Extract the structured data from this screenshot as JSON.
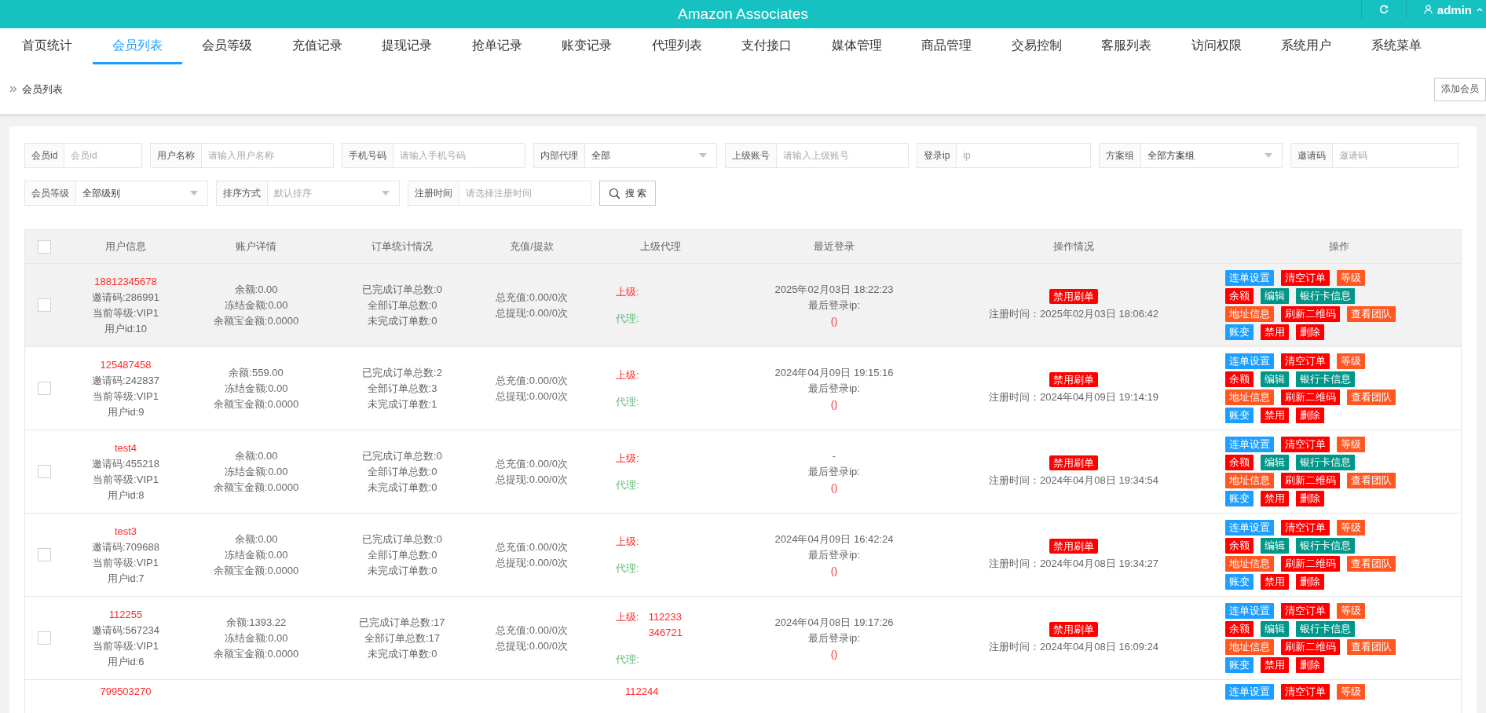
{
  "header": {
    "title": "Amazon Associates",
    "user": "admin"
  },
  "nav": [
    {
      "label": "首页统计",
      "selected": false
    },
    {
      "label": "会员列表",
      "selected": true
    },
    {
      "label": "会员等级",
      "selected": false
    },
    {
      "label": "充值记录",
      "selected": false
    },
    {
      "label": "提现记录",
      "selected": false
    },
    {
      "label": "抢单记录",
      "selected": false
    },
    {
      "label": "账变记录",
      "selected": false
    },
    {
      "label": "代理列表",
      "selected": false
    },
    {
      "label": "支付接口",
      "selected": false
    },
    {
      "label": "媒体管理",
      "selected": false
    },
    {
      "label": "商品管理",
      "selected": false
    },
    {
      "label": "交易控制",
      "selected": false
    },
    {
      "label": "客服列表",
      "selected": false
    },
    {
      "label": "访问权限",
      "selected": false
    },
    {
      "label": "系统用户",
      "selected": false
    },
    {
      "label": "系统菜单",
      "selected": false
    }
  ],
  "breadcrumb": "会员列表",
  "add_button": "添加会员",
  "filters": [
    {
      "label": "会员id",
      "kind": "input",
      "placeholder": "会员id"
    },
    {
      "label": "用户名称",
      "kind": "input",
      "placeholder": "请输入用户名称"
    },
    {
      "label": "手机号码",
      "kind": "input",
      "placeholder": "请输入手机号码"
    },
    {
      "label": "内部代理",
      "kind": "select",
      "value": "全部"
    },
    {
      "label": "上级账号",
      "kind": "input",
      "placeholder": "请输入上级账号"
    },
    {
      "label": "登录ip",
      "kind": "input",
      "placeholder": "ip"
    },
    {
      "label": "方案组",
      "kind": "select",
      "value": "全部方案组"
    },
    {
      "label": "邀请码",
      "kind": "input",
      "placeholder": "邀请码"
    },
    {
      "label": "会员等级",
      "kind": "select",
      "value": "全部级别"
    },
    {
      "label": "排序方式",
      "kind": "select",
      "placeholder": "默认排序"
    },
    {
      "label": "注册时间",
      "kind": "input",
      "placeholder": "请选择注册时间"
    }
  ],
  "search_button": "搜 索",
  "table": {
    "select_all_checked": false,
    "columns": [
      "用户信息",
      "账户详情",
      "订单统计情况",
      "充值/提款",
      "上级代理",
      "最近登录",
      "操作情况",
      "操作"
    ],
    "rows": [
      {
        "checked": false,
        "highlighted": true,
        "user": {
          "name": "18812345678",
          "lines": [
            "邀请码:286991",
            "当前等级:VIP1",
            "用户id:10"
          ]
        },
        "account": [
          "余额:0.00",
          "冻结金额:0.00",
          "余额宝金额:0.0000"
        ],
        "orders": [
          "已完成订单总数:0",
          "全部订单总数:0",
          "未完成订单数:0"
        ],
        "funds": [
          "总充值:0.00/0次",
          "总提现:0.00/0次"
        ],
        "superior": {
          "label": "上级:",
          "agent_label": "代理:"
        },
        "login": {
          "time": "2025年02月03日 18:22:23",
          "ip_label": "最后登录ip:",
          "ip": "()"
        },
        "status": {
          "badge": "禁用刷单",
          "registered": "注册时间：2025年02月03日 18:06:42"
        },
        "action_rows": [
          [
            {
              "label": "连单设置",
              "color": "#1e9fff"
            },
            {
              "label": "清空订单",
              "color": "#ff0000"
            },
            {
              "label": "等级",
              "color": "#ff5722"
            }
          ],
          [
            {
              "label": "余额",
              "color": "#ff0000"
            },
            {
              "label": "编辑",
              "color": "#009688"
            },
            {
              "label": "银行卡信息",
              "color": "#009688"
            }
          ],
          [
            {
              "label": "地址信息",
              "color": "#ff5722"
            },
            {
              "label": "刷新二维码",
              "color": "#ff0000"
            },
            {
              "label": "查看团队",
              "color": "#ff5722"
            }
          ],
          [
            {
              "label": "账变",
              "color": "#1e9fff"
            },
            {
              "label": "禁用",
              "color": "#ff0000"
            },
            {
              "label": "删除",
              "color": "#ff0000"
            }
          ]
        ]
      },
      {
        "checked": false,
        "highlighted": false,
        "user": {
          "name": "125487458",
          "lines": [
            "邀请码:242837",
            "当前等级:VIP1",
            "用户id:9"
          ]
        },
        "account": [
          "余额:559.00",
          "冻结金额:0.00",
          "余额宝金额:0.0000"
        ],
        "orders": [
          "已完成订单总数:2",
          "全部订单总数:3",
          "未完成订单数:1"
        ],
        "funds": [
          "总充值:0.00/0次",
          "总提现:0.00/0次"
        ],
        "superior": {
          "label": "上级:",
          "agent_label": "代理:"
        },
        "login": {
          "time": "2024年04月09日 19:15:16",
          "ip_label": "最后登录ip:",
          "ip": "()"
        },
        "status": {
          "badge": "禁用刷单",
          "registered": "注册时间：2024年04月09日 19:14:19"
        },
        "action_rows": [
          [
            {
              "label": "连单设置",
              "color": "#1e9fff"
            },
            {
              "label": "清空订单",
              "color": "#ff0000"
            },
            {
              "label": "等级",
              "color": "#ff5722"
            }
          ],
          [
            {
              "label": "余额",
              "color": "#ff0000"
            },
            {
              "label": "编辑",
              "color": "#009688"
            },
            {
              "label": "银行卡信息",
              "color": "#009688"
            }
          ],
          [
            {
              "label": "地址信息",
              "color": "#ff5722"
            },
            {
              "label": "刷新二维码",
              "color": "#ff0000"
            },
            {
              "label": "查看团队",
              "color": "#ff5722"
            }
          ],
          [
            {
              "label": "账变",
              "color": "#1e9fff"
            },
            {
              "label": "禁用",
              "color": "#ff0000"
            },
            {
              "label": "删除",
              "color": "#ff0000"
            }
          ]
        ]
      },
      {
        "checked": false,
        "highlighted": false,
        "user": {
          "name": "test4",
          "lines": [
            "邀请码:455218",
            "当前等级:VIP1",
            "用户id:8"
          ]
        },
        "account": [
          "余额:0.00",
          "冻结金额:0.00",
          "余额宝金额:0.0000"
        ],
        "orders": [
          "已完成订单总数:0",
          "全部订单总数:0",
          "未完成订单数:0"
        ],
        "funds": [
          "总充值:0.00/0次",
          "总提现:0.00/0次"
        ],
        "superior": {
          "label": "上级:",
          "agent_label": "代理:"
        },
        "login": {
          "time": "-",
          "ip_label": "最后登录ip:",
          "ip": "()"
        },
        "status": {
          "badge": "禁用刷单",
          "registered": "注册时间：2024年04月08日 19:34:54"
        },
        "action_rows": [
          [
            {
              "label": "连单设置",
              "color": "#1e9fff"
            },
            {
              "label": "清空订单",
              "color": "#ff0000"
            },
            {
              "label": "等级",
              "color": "#ff5722"
            }
          ],
          [
            {
              "label": "余额",
              "color": "#ff0000"
            },
            {
              "label": "编辑",
              "color": "#009688"
            },
            {
              "label": "银行卡信息",
              "color": "#009688"
            }
          ],
          [
            {
              "label": "地址信息",
              "color": "#ff5722"
            },
            {
              "label": "刷新二维码",
              "color": "#ff0000"
            },
            {
              "label": "查看团队",
              "color": "#ff5722"
            }
          ],
          [
            {
              "label": "账变",
              "color": "#1e9fff"
            },
            {
              "label": "禁用",
              "color": "#ff0000"
            },
            {
              "label": "删除",
              "color": "#ff0000"
            }
          ]
        ]
      },
      {
        "checked": false,
        "highlighted": false,
        "user": {
          "name": "test3",
          "lines": [
            "邀请码:709688",
            "当前等级:VIP1",
            "用户id:7"
          ]
        },
        "account": [
          "余额:0.00",
          "冻结金额:0.00",
          "余额宝金额:0.0000"
        ],
        "orders": [
          "已完成订单总数:0",
          "全部订单总数:0",
          "未完成订单数:0"
        ],
        "funds": [
          "总充值:0.00/0次",
          "总提现:0.00/0次"
        ],
        "superior": {
          "label": "上级:",
          "agent_label": "代理:"
        },
        "login": {
          "time": "2024年04月09日 16:42:24",
          "ip_label": "最后登录ip:",
          "ip": "()"
        },
        "status": {
          "badge": "禁用刷单",
          "registered": "注册时间：2024年04月08日 19:34:27"
        },
        "action_rows": [
          [
            {
              "label": "连单设置",
              "color": "#1e9fff"
            },
            {
              "label": "清空订单",
              "color": "#ff0000"
            },
            {
              "label": "等级",
              "color": "#ff5722"
            }
          ],
          [
            {
              "label": "余额",
              "color": "#ff0000"
            },
            {
              "label": "编辑",
              "color": "#009688"
            },
            {
              "label": "银行卡信息",
              "color": "#009688"
            }
          ],
          [
            {
              "label": "地址信息",
              "color": "#ff5722"
            },
            {
              "label": "刷新二维码",
              "color": "#ff0000"
            },
            {
              "label": "查看团队",
              "color": "#ff5722"
            }
          ],
          [
            {
              "label": "账变",
              "color": "#1e9fff"
            },
            {
              "label": "禁用",
              "color": "#ff0000"
            },
            {
              "label": "删除",
              "color": "#ff0000"
            }
          ]
        ]
      },
      {
        "checked": false,
        "highlighted": false,
        "user": {
          "name": "112255",
          "lines": [
            "邀请码:567234",
            "当前等级:VIP1",
            "用户id:6"
          ]
        },
        "account": [
          "余额:1393.22",
          "冻结金额:0.00",
          "余额宝金额:0.0000"
        ],
        "orders": [
          "已完成订单总数:17",
          "全部订单总数:17",
          "未完成订单数:0"
        ],
        "funds": [
          "总充值:0.00/0次",
          "总提现:0.00/0次"
        ],
        "superior": {
          "label": "上级:",
          "values": [
            "112233",
            "346721"
          ],
          "agent_label": "代理:"
        },
        "login": {
          "time": "2024年04月08日 19:17:26",
          "ip_label": "最后登录ip:",
          "ip": "()"
        },
        "status": {
          "badge": "禁用刷单",
          "registered": "注册时间：2024年04月08日 16:09:24"
        },
        "action_rows": [
          [
            {
              "label": "连单设置",
              "color": "#1e9fff"
            },
            {
              "label": "清空订单",
              "color": "#ff0000"
            },
            {
              "label": "等级",
              "color": "#ff5722"
            }
          ],
          [
            {
              "label": "余额",
              "color": "#ff0000"
            },
            {
              "label": "编辑",
              "color": "#009688"
            },
            {
              "label": "银行卡信息",
              "color": "#009688"
            }
          ],
          [
            {
              "label": "地址信息",
              "color": "#ff5722"
            },
            {
              "label": "刷新二维码",
              "color": "#ff0000"
            },
            {
              "label": "查看团队",
              "color": "#ff5722"
            }
          ],
          [
            {
              "label": "账变",
              "color": "#1e9fff"
            },
            {
              "label": "禁用",
              "color": "#ff0000"
            },
            {
              "label": "删除",
              "color": "#ff0000"
            }
          ]
        ]
      },
      {
        "highlighted": false,
        "user": {
          "name": "799503270"
        },
        "superior": {
          "values": [
            "112244"
          ]
        },
        "action_rows": [
          [
            {
              "label": "连单设置",
              "color": "#1e9fff"
            },
            {
              "label": "清空订单",
              "color": "#ff0000"
            },
            {
              "label": "等级",
              "color": "#ff5722"
            }
          ]
        ]
      }
    ]
  }
}
